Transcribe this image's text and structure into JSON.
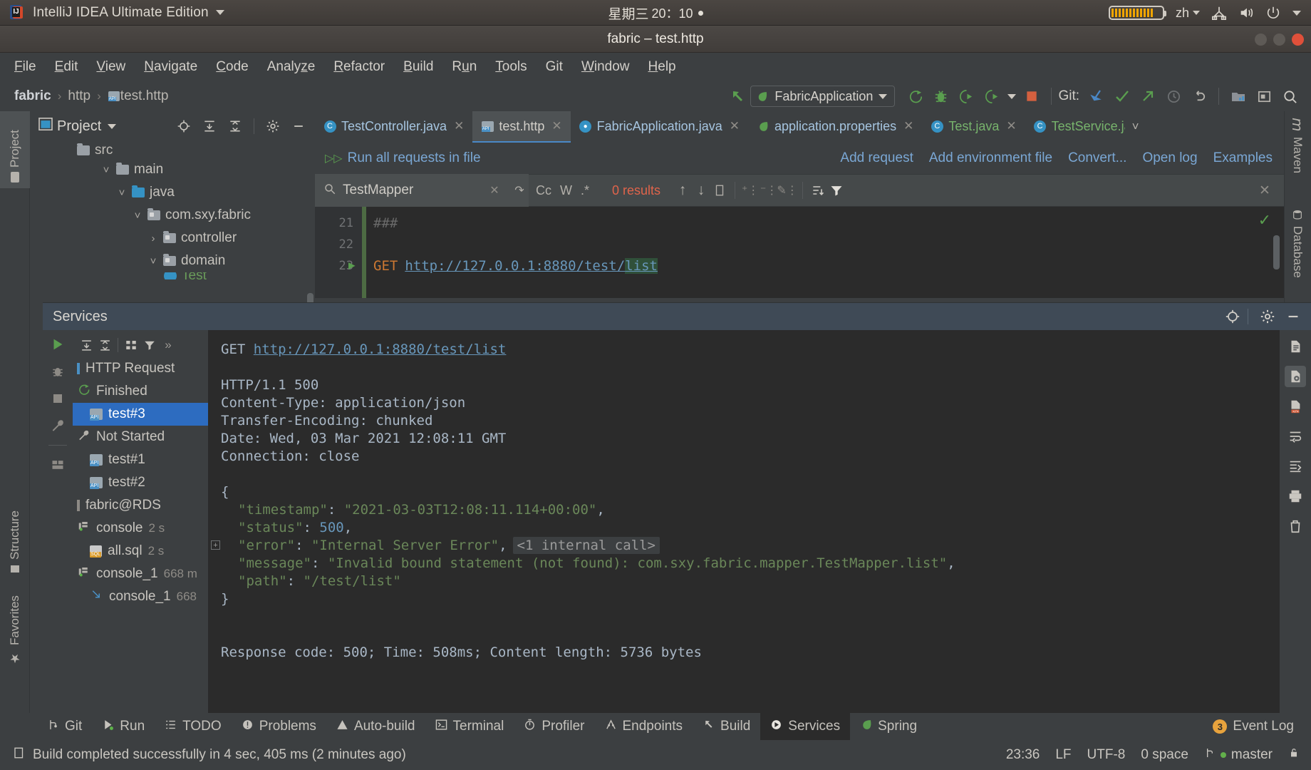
{
  "os_bar": {
    "app_name": "IntelliJ IDEA Ultimate Edition",
    "clock_day": "星期三",
    "clock_time": "20：10",
    "language": "zh",
    "icons": [
      "battery-icon",
      "network-icon",
      "volume-icon",
      "power-icon",
      "caret-down-icon"
    ]
  },
  "window": {
    "title": "fabric – test.http",
    "buttons": [
      "minimize-button",
      "maximize-button",
      "close-button"
    ]
  },
  "menubar": {
    "items": [
      {
        "label": "File",
        "mnemonic": "F"
      },
      {
        "label": "Edit",
        "mnemonic": "E"
      },
      {
        "label": "View",
        "mnemonic": "V"
      },
      {
        "label": "Navigate",
        "mnemonic": "N"
      },
      {
        "label": "Code",
        "mnemonic": "C"
      },
      {
        "label": "Analyze",
        "mnemonic": "z"
      },
      {
        "label": "Refactor",
        "mnemonic": "R"
      },
      {
        "label": "Build",
        "mnemonic": "B"
      },
      {
        "label": "Run",
        "mnemonic": "u"
      },
      {
        "label": "Tools",
        "mnemonic": "T"
      },
      {
        "label": "Git",
        "mnemonic": ""
      },
      {
        "label": "Window",
        "mnemonic": "W"
      },
      {
        "label": "Help",
        "mnemonic": "H"
      }
    ]
  },
  "navbar": {
    "breadcrumbs": [
      "fabric",
      "http",
      "test.http"
    ],
    "run_config": "FabricApplication",
    "git_label": "Git:",
    "toolbar_icons": [
      "back-arrow-icon",
      "run-icon",
      "debug-icon",
      "run-with-coverage-icon",
      "profile-icon",
      "stop-icon",
      "update-project-icon",
      "commit-icon",
      "push-icon",
      "history-icon",
      "rollback-icon",
      "open-file-icon",
      "hide-window-icon",
      "search-everywhere-icon"
    ]
  },
  "left_strip": {
    "tabs": [
      {
        "label": "Project",
        "icon": "project-folder-icon",
        "active": true
      },
      {
        "label": "Structure",
        "icon": "structure-icon",
        "active": false
      },
      {
        "label": "Favorites",
        "icon": "star-icon",
        "active": false
      }
    ]
  },
  "right_strip": {
    "tabs": [
      {
        "label": "Maven",
        "icon": "maven-icon"
      },
      {
        "label": "Database",
        "icon": "database-icon"
      }
    ]
  },
  "project_panel": {
    "title": "Project",
    "header_icons": [
      "locate-icon",
      "expand-all-icon",
      "collapse-all-icon",
      "gear-icon",
      "minimize-icon"
    ],
    "tree": [
      {
        "label": "src",
        "indent": 0,
        "chevron": "",
        "icon": "folder",
        "cut": true
      },
      {
        "label": "main",
        "indent": 1,
        "chevron": "v",
        "icon": "folder"
      },
      {
        "label": "java",
        "indent": 2,
        "chevron": "v",
        "icon": "folder-blue"
      },
      {
        "label": "com.sxy.fabric",
        "indent": 3,
        "chevron": "v",
        "icon": "folder-package"
      },
      {
        "label": "controller",
        "indent": 4,
        "chevron": ">",
        "icon": "folder-package"
      },
      {
        "label": "domain",
        "indent": 4,
        "chevron": "v",
        "icon": "folder-package"
      },
      {
        "label": "Test",
        "indent": 5,
        "chevron": "",
        "icon": "class-icon",
        "clipped": true
      }
    ]
  },
  "editor": {
    "tabs": [
      {
        "label": "TestController.java",
        "icon": "java-class-icon",
        "color": "blue",
        "active": false,
        "closable": true
      },
      {
        "label": "test.http",
        "icon": "http-request-icon",
        "color": "plain",
        "active": true,
        "closable": true
      },
      {
        "label": "FabricApplication.java",
        "icon": "spring-bean-icon",
        "color": "blue",
        "active": false,
        "closable": true
      },
      {
        "label": "application.properties",
        "icon": "spring-leaf-icon",
        "color": "blue",
        "active": false,
        "closable": true
      },
      {
        "label": "Test.java",
        "icon": "java-class-icon",
        "color": "green",
        "active": false,
        "closable": true
      },
      {
        "label": "TestService.ja",
        "icon": "java-class-icon",
        "color": "green",
        "active": false,
        "closable": false
      }
    ],
    "tab_overflow_icon": "chevron-down-icon",
    "action_bar": {
      "run_all": "Run all requests in file",
      "links": [
        "Add request",
        "Add environment file",
        "Convert...",
        "Open log",
        "Examples"
      ]
    },
    "find_bar": {
      "query": "TestMapper",
      "results": "0 results",
      "options": [
        "Cc",
        "W",
        ".*"
      ],
      "icons": [
        "search-icon",
        "clear-icon",
        "history-icon",
        "prev-match-icon",
        "next-match-icon",
        "select-all-icon",
        "add-line-icon",
        "remove-line-icon",
        "edit-line-icon",
        "filter-scope-icon",
        "filter-icon",
        "close-icon"
      ]
    },
    "code": {
      "lines": [
        {
          "num": "21",
          "text": "###",
          "type": "comment"
        },
        {
          "num": "22",
          "text": "",
          "type": "blank"
        },
        {
          "num": "23",
          "method": "GET",
          "url": "http://127.0.0.1:8880/test/",
          "url_highlight": "list",
          "type": "request",
          "gutter_run": true
        }
      ],
      "inspection_status": "ok-check-icon"
    }
  },
  "services": {
    "title": "Services",
    "header_icons": [
      "locate-icon",
      "gear-icon",
      "minimize-icon"
    ],
    "tool_icons": [
      "run-icon",
      "expand-all-icon",
      "collapse-all-icon",
      "group-icon",
      "filter-icon",
      "more-icon"
    ],
    "side_icons": [
      "debug-icon",
      "stop-icon",
      "settings-wrench-icon",
      "layout-icon"
    ],
    "tree": [
      {
        "label": "HTTP Request",
        "indent": 0,
        "icon": "http-group-icon",
        "time": ""
      },
      {
        "label": "Finished",
        "indent": 0,
        "icon": "finished-icon",
        "time": ""
      },
      {
        "label": "test#3",
        "indent": 1,
        "icon": "http-request-icon",
        "time": "",
        "selected": true
      },
      {
        "label": "Not Started",
        "indent": 0,
        "icon": "wrench-icon",
        "time": ""
      },
      {
        "label": "test#1",
        "indent": 1,
        "icon": "http-request-icon",
        "time": ""
      },
      {
        "label": "test#2",
        "indent": 1,
        "icon": "http-request-icon",
        "time": ""
      },
      {
        "label": "fabric@RDS",
        "indent": 0,
        "icon": "datasource-icon",
        "time": ""
      },
      {
        "label": "console",
        "indent": 0,
        "icon": "console-icon",
        "time": "2 s"
      },
      {
        "label": "all.sql",
        "indent": 1,
        "icon": "sql-file-icon",
        "time": "2 s"
      },
      {
        "label": "console_1",
        "indent": 0,
        "icon": "console-icon",
        "time": "668 m"
      },
      {
        "label": "console_1",
        "indent": 1,
        "icon": "query-icon",
        "time": "668"
      }
    ],
    "response": {
      "request_method": "GET",
      "request_url": "http://127.0.0.1:8880/test/list",
      "headers": [
        "HTTP/1.1 500",
        "Content-Type: application/json",
        "Transfer-Encoding: chunked",
        "Date: Wed, 03 Mar 2021 12:08:11 GMT",
        "Connection: close"
      ],
      "body": {
        "open_brace": "{",
        "fields": [
          {
            "key": "\"timestamp\"",
            "sep": ": ",
            "value": "\"2021-03-03T12:08:11.114+00:00\"",
            "tail": ",",
            "kind": "string"
          },
          {
            "key": "\"status\"",
            "sep": ": ",
            "value": "500",
            "tail": ",",
            "kind": "number"
          },
          {
            "key": "\"error\"",
            "sep": ": ",
            "value": "\"Internal Server Error\"",
            "tail": ",",
            "kind": "string",
            "fold": "<1 internal call>",
            "fold_marker": true
          },
          {
            "key": "\"message\"",
            "sep": ": ",
            "value": "\"Invalid bound statement (not found): com.sxy.fabric.mapper.TestMapper.list\"",
            "tail": ",",
            "kind": "string"
          },
          {
            "key": "\"path\"",
            "sep": ": ",
            "value": "\"/test/list\"",
            "tail": "",
            "kind": "string"
          }
        ],
        "close_brace": "}"
      },
      "footer": "Response code: 500; Time: 508ms; Content length: 5736 bytes"
    },
    "right_icons": [
      "file-icon",
      "format-file-icon",
      "code-file-icon",
      "soft-wrap-icon",
      "scroll-to-end-icon",
      "print-icon",
      "delete-icon"
    ]
  },
  "bottom_bar": {
    "tabs": [
      {
        "label": "Git",
        "icon": "git-branch-icon",
        "active": false
      },
      {
        "label": "Run",
        "icon": "run-icon",
        "active": false
      },
      {
        "label": "TODO",
        "icon": "todo-icon",
        "active": false
      },
      {
        "label": "Problems",
        "icon": "problems-icon",
        "active": false
      },
      {
        "label": "Auto-build",
        "icon": "warning-icon",
        "active": false
      },
      {
        "label": "Terminal",
        "icon": "terminal-icon",
        "active": false
      },
      {
        "label": "Profiler",
        "icon": "profiler-icon",
        "active": false
      },
      {
        "label": "Endpoints",
        "icon": "endpoints-icon",
        "active": false
      },
      {
        "label": "Build",
        "icon": "build-hammer-icon",
        "active": false
      },
      {
        "label": "Services",
        "icon": "services-icon",
        "active": true
      },
      {
        "label": "Spring",
        "icon": "spring-leaf-icon",
        "active": false
      }
    ],
    "event_log": {
      "label": "Event Log",
      "count": "3"
    }
  },
  "status_bar": {
    "message": "Build completed successfully in 4 sec, 405 ms (2 minutes ago)",
    "message_icon": "build-status-icon",
    "caret": "23:36",
    "line_separator": "LF",
    "encoding": "UTF-8",
    "indent": "0 space",
    "branch": "master",
    "lock_icon": "lock-icon"
  }
}
